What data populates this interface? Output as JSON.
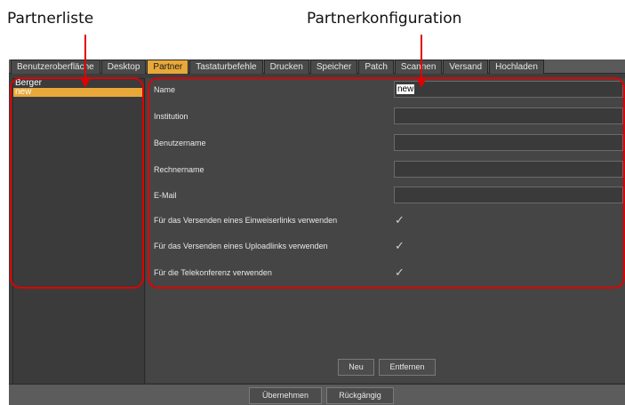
{
  "annotations": {
    "left_label": "Partnerliste",
    "right_label": "Partnerkonfiguration"
  },
  "tabs": [
    {
      "label": "Benutzeroberfläche",
      "active": false
    },
    {
      "label": "Desktop",
      "active": false
    },
    {
      "label": "Partner",
      "active": true
    },
    {
      "label": "Tastaturbefehle",
      "active": false
    },
    {
      "label": "Drucken",
      "active": false
    },
    {
      "label": "Speicher",
      "active": false
    },
    {
      "label": "Patch",
      "active": false
    },
    {
      "label": "Scannen",
      "active": false
    },
    {
      "label": "Versand",
      "active": false
    },
    {
      "label": "Hochladen",
      "active": false
    }
  ],
  "partners": [
    {
      "name": "Berger",
      "selected": false
    },
    {
      "name": "new",
      "selected": true
    }
  ],
  "form": {
    "name_label": "Name",
    "name_value": "new",
    "institution_label": "Institution",
    "institution_value": "",
    "username_label": "Benutzername",
    "username_value": "",
    "computer_label": "Rechnername",
    "computer_value": "",
    "email_label": "E-Mail",
    "email_value": "",
    "referral_label": "Für das Versenden eines Einweiserlinks verwenden",
    "referral_checked": true,
    "upload_label": "Für das Versenden eines Uploadlinks verwenden",
    "upload_checked": true,
    "teleconf_label": "Für die Telekonferenz verwenden",
    "teleconf_checked": true,
    "checkmark": "✓"
  },
  "buttons": {
    "new": "Neu",
    "remove": "Entfernen",
    "apply": "Übernehmen",
    "revert": "Rückgängig"
  },
  "colors": {
    "accent": "#e8a93a",
    "annotation": "#e00000"
  }
}
